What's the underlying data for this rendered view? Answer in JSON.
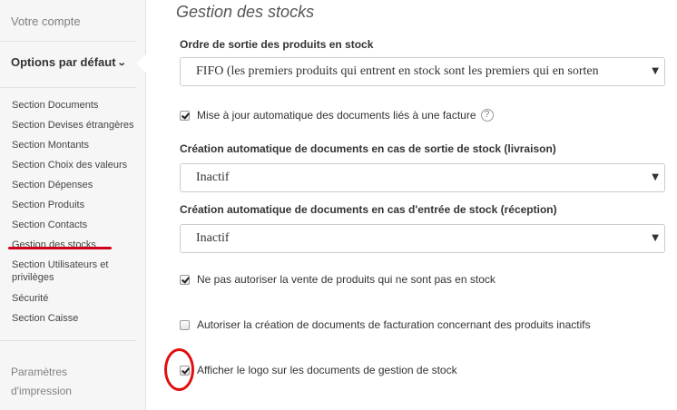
{
  "sidebar": {
    "account": "Votre compte",
    "defaults_label": "Options par défaut",
    "items": [
      "Section Documents",
      "Section Devises étrangères",
      "Section Montants",
      "Section Choix des valeurs",
      "Section Dépenses",
      "Section Produits",
      "Section Contacts",
      "Gestion des stocks",
      "Section Utilisateurs et privilèges",
      "Sécurité",
      "Section Caisse"
    ],
    "print_settings": "Paramètres d'impression"
  },
  "main": {
    "title": "Gestion des stocks",
    "stock_order": {
      "label": "Ordre de sortie des produits en stock",
      "value": "FIFO (les premiers produits qui entrent en stock sont les premiers qui en sorten"
    },
    "auto_update": {
      "label": "Mise à jour automatique des documents liés à une facture",
      "checked": true,
      "help": "?"
    },
    "auto_create_out": {
      "label": "Création automatique de documents en cas de sortie de stock (livraison)",
      "value": "Inactif"
    },
    "auto_create_in": {
      "label": "Création automatique de documents en cas d'entrée de stock (réception)",
      "value": "Inactif"
    },
    "no_sale_out_of_stock": {
      "label": "Ne pas autoriser la vente de produits qui ne sont pas en stock",
      "checked": true
    },
    "allow_inactive_billing": {
      "label": "Autoriser la création de documents de facturation concernant des produits inactifs",
      "checked": false
    },
    "show_logo": {
      "label": "Afficher le logo sur les documents de gestion de stock",
      "checked": true
    }
  },
  "colors": {
    "highlight": "#e01010",
    "sidebar_bg": "#f6f6f6"
  }
}
